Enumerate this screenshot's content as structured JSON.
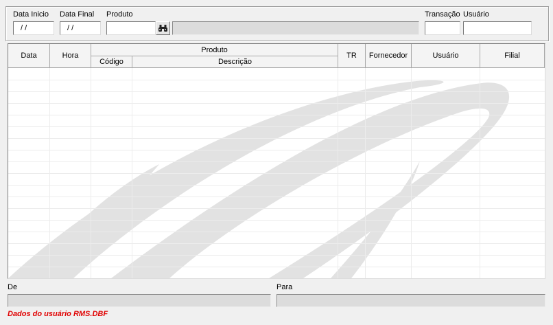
{
  "filters": {
    "date_start": {
      "label": "Data Inicio",
      "value": " / /"
    },
    "date_end": {
      "label": "Data Final",
      "value": " / /"
    },
    "product": {
      "label": "Produto",
      "value": "",
      "description": ""
    },
    "transaction": {
      "label": "Transação",
      "value": ""
    },
    "user": {
      "label": "Usuário",
      "value": ""
    },
    "search_icon": "binoculars-icon"
  },
  "grid": {
    "columns": {
      "date": "Data",
      "time": "Hora",
      "product_group": "Produto",
      "product_code": "Código",
      "product_description": "Descrição",
      "tr": "TR",
      "supplier": "Fornecedor",
      "user": "Usuário",
      "branch": "Filial"
    },
    "rows": []
  },
  "footer": {
    "from_label": "De",
    "from_value": "",
    "to_label": "Para",
    "to_value": ""
  },
  "status": {
    "message": "Dados do usuário RMS.DBF",
    "color": "#e00000"
  }
}
